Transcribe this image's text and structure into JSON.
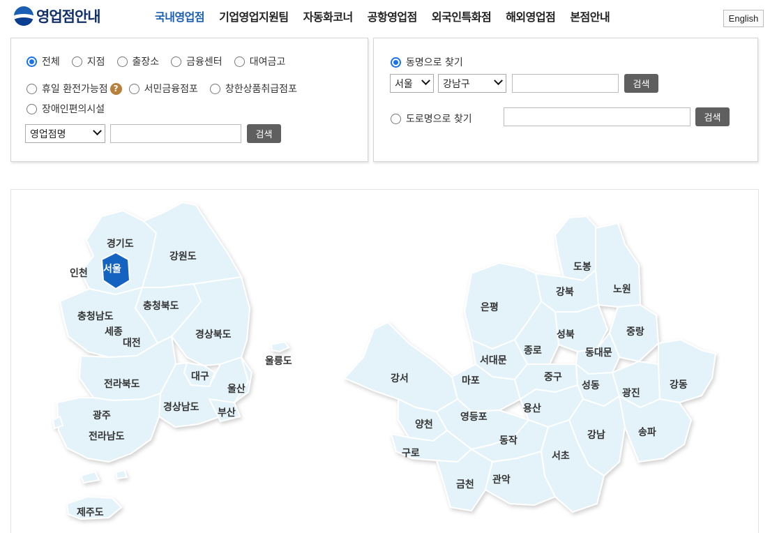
{
  "header": {
    "logo_text": "영업점안내",
    "nav": [
      {
        "label": "국내영업점",
        "active": true
      },
      {
        "label": "기업영업지원팀",
        "active": false
      },
      {
        "label": "자동화코너",
        "active": false
      },
      {
        "label": "공항영업점",
        "active": false
      },
      {
        "label": "외국인특화점",
        "active": false
      },
      {
        "label": "해외영업점",
        "active": false
      },
      {
        "label": "본점안내",
        "active": false
      }
    ],
    "english_label": "English"
  },
  "search_left": {
    "types": [
      {
        "label": "전체",
        "checked": true
      },
      {
        "label": "지점",
        "checked": false
      },
      {
        "label": "출장소",
        "checked": false
      },
      {
        "label": "금융센터",
        "checked": false
      },
      {
        "label": "대여금고",
        "checked": false
      },
      {
        "label": "휴일 환전가능점",
        "checked": false
      },
      {
        "label": "서민금융점포",
        "checked": false
      },
      {
        "label": "창한상품취급점포",
        "checked": false
      },
      {
        "label": "장애인편의시설",
        "checked": false
      }
    ],
    "field_select": "영업점명",
    "input_value": "",
    "search_label": "검색"
  },
  "search_right": {
    "dong": {
      "label": "동명으로 찾기",
      "checked": true,
      "city": "서울",
      "district": "강남구",
      "input_value": "",
      "search_label": "검색"
    },
    "road": {
      "label": "도로명으로 찾기",
      "checked": false,
      "input_value": "",
      "search_label": "검색"
    }
  },
  "map_korea": {
    "selected": "서울",
    "regions": [
      "경기도",
      "강원도",
      "인천",
      "서울",
      "충청북도",
      "충청남도",
      "세종",
      "대전",
      "경상북도",
      "울릉도",
      "대구",
      "울산",
      "전라북도",
      "경상남도",
      "부산",
      "광주",
      "전라남도",
      "제주도"
    ]
  },
  "map_seoul": {
    "districts": [
      "도봉",
      "강북",
      "노원",
      "은평",
      "성북",
      "중랑",
      "종로",
      "동대문",
      "서대문",
      "강서",
      "마포",
      "중구",
      "성동",
      "광진",
      "강동",
      "용산",
      "양천",
      "영등포",
      "동작",
      "강남",
      "송파",
      "구로",
      "서초",
      "금천",
      "관악"
    ]
  },
  "colors": {
    "accent": "#1a5fb4",
    "map_fill": "#e4f3f9",
    "map_border": "#ffffff",
    "selected": "#1563c0",
    "button": "#5f5f5f"
  }
}
